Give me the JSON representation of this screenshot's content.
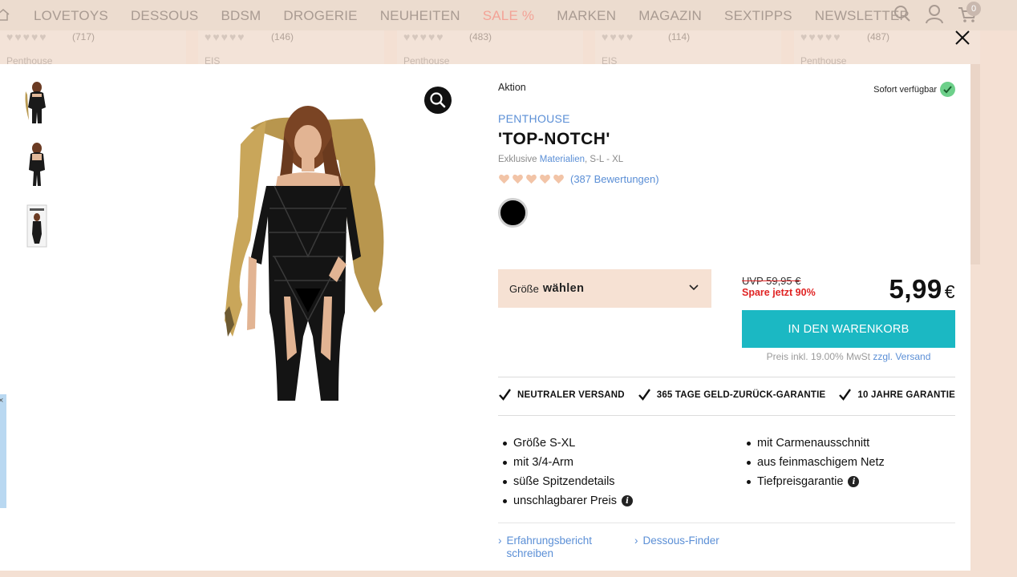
{
  "background": {
    "nav_items": [
      "LOVETOYS",
      "DESSOUS",
      "BDSM",
      "DROGERIE",
      "NEUHEITEN",
      "SALE %",
      "MARKEN",
      "MAGAZIN",
      "SEXTIPPS",
      "NEWSLETTER"
    ],
    "cart_count": "0",
    "cards": [
      {
        "count": "(717)",
        "brand": "Penthouse"
      },
      {
        "count": "(146)",
        "brand": "EIS"
      },
      {
        "count": "(483)",
        "brand": "Penthouse"
      },
      {
        "count": "(114)",
        "brand": "EIS"
      },
      {
        "count": "(487)",
        "brand": "Penthouse"
      }
    ]
  },
  "product": {
    "aktion": "Aktion",
    "availability": "Sofort verfügbar",
    "brand": "PENTHOUSE",
    "title": "'TOP-NOTCH'",
    "subtitle_prefix": "Exklusive ",
    "subtitle_link": "Materialien",
    "subtitle_suffix": ", S-L - XL",
    "rating_value": 5,
    "rating_count": "(387 Bewertungen)",
    "size_label": "Größe",
    "size_action": "wählen",
    "uvp": "UVP 59,95 €",
    "savings": "Spare jetzt 90%",
    "price": "5,99",
    "currency": "€",
    "cart_button": "IN DEN WARENKORB",
    "tax_prefix": "Preis inkl. 19.00% MwSt ",
    "tax_link": "zzgl. Versand",
    "guarantees": [
      "NEUTRALER VERSAND",
      "365 TAGE GELD-ZURÜCK-GARANTIE",
      "10 JAHRE GARANTIE"
    ],
    "features_left": [
      "Größe S-XL",
      "mit 3/4-Arm",
      "süße Spitzendetails",
      "unschlagbarer Preis"
    ],
    "features_right": [
      "mit Carmenausschnitt",
      "aus feinmaschigem Netz",
      "Tiefpreisgarantie"
    ],
    "link_review": "Erfahrungsbericht schreiben",
    "link_finder": "Dessous-Finder"
  },
  "colors": {
    "accent_blue": "#5b8fd6",
    "cart_button": "#1bb8c3",
    "sale_red": "#e02424",
    "size_bg": "#f6e1d3",
    "available_green": "#6dd08a"
  }
}
